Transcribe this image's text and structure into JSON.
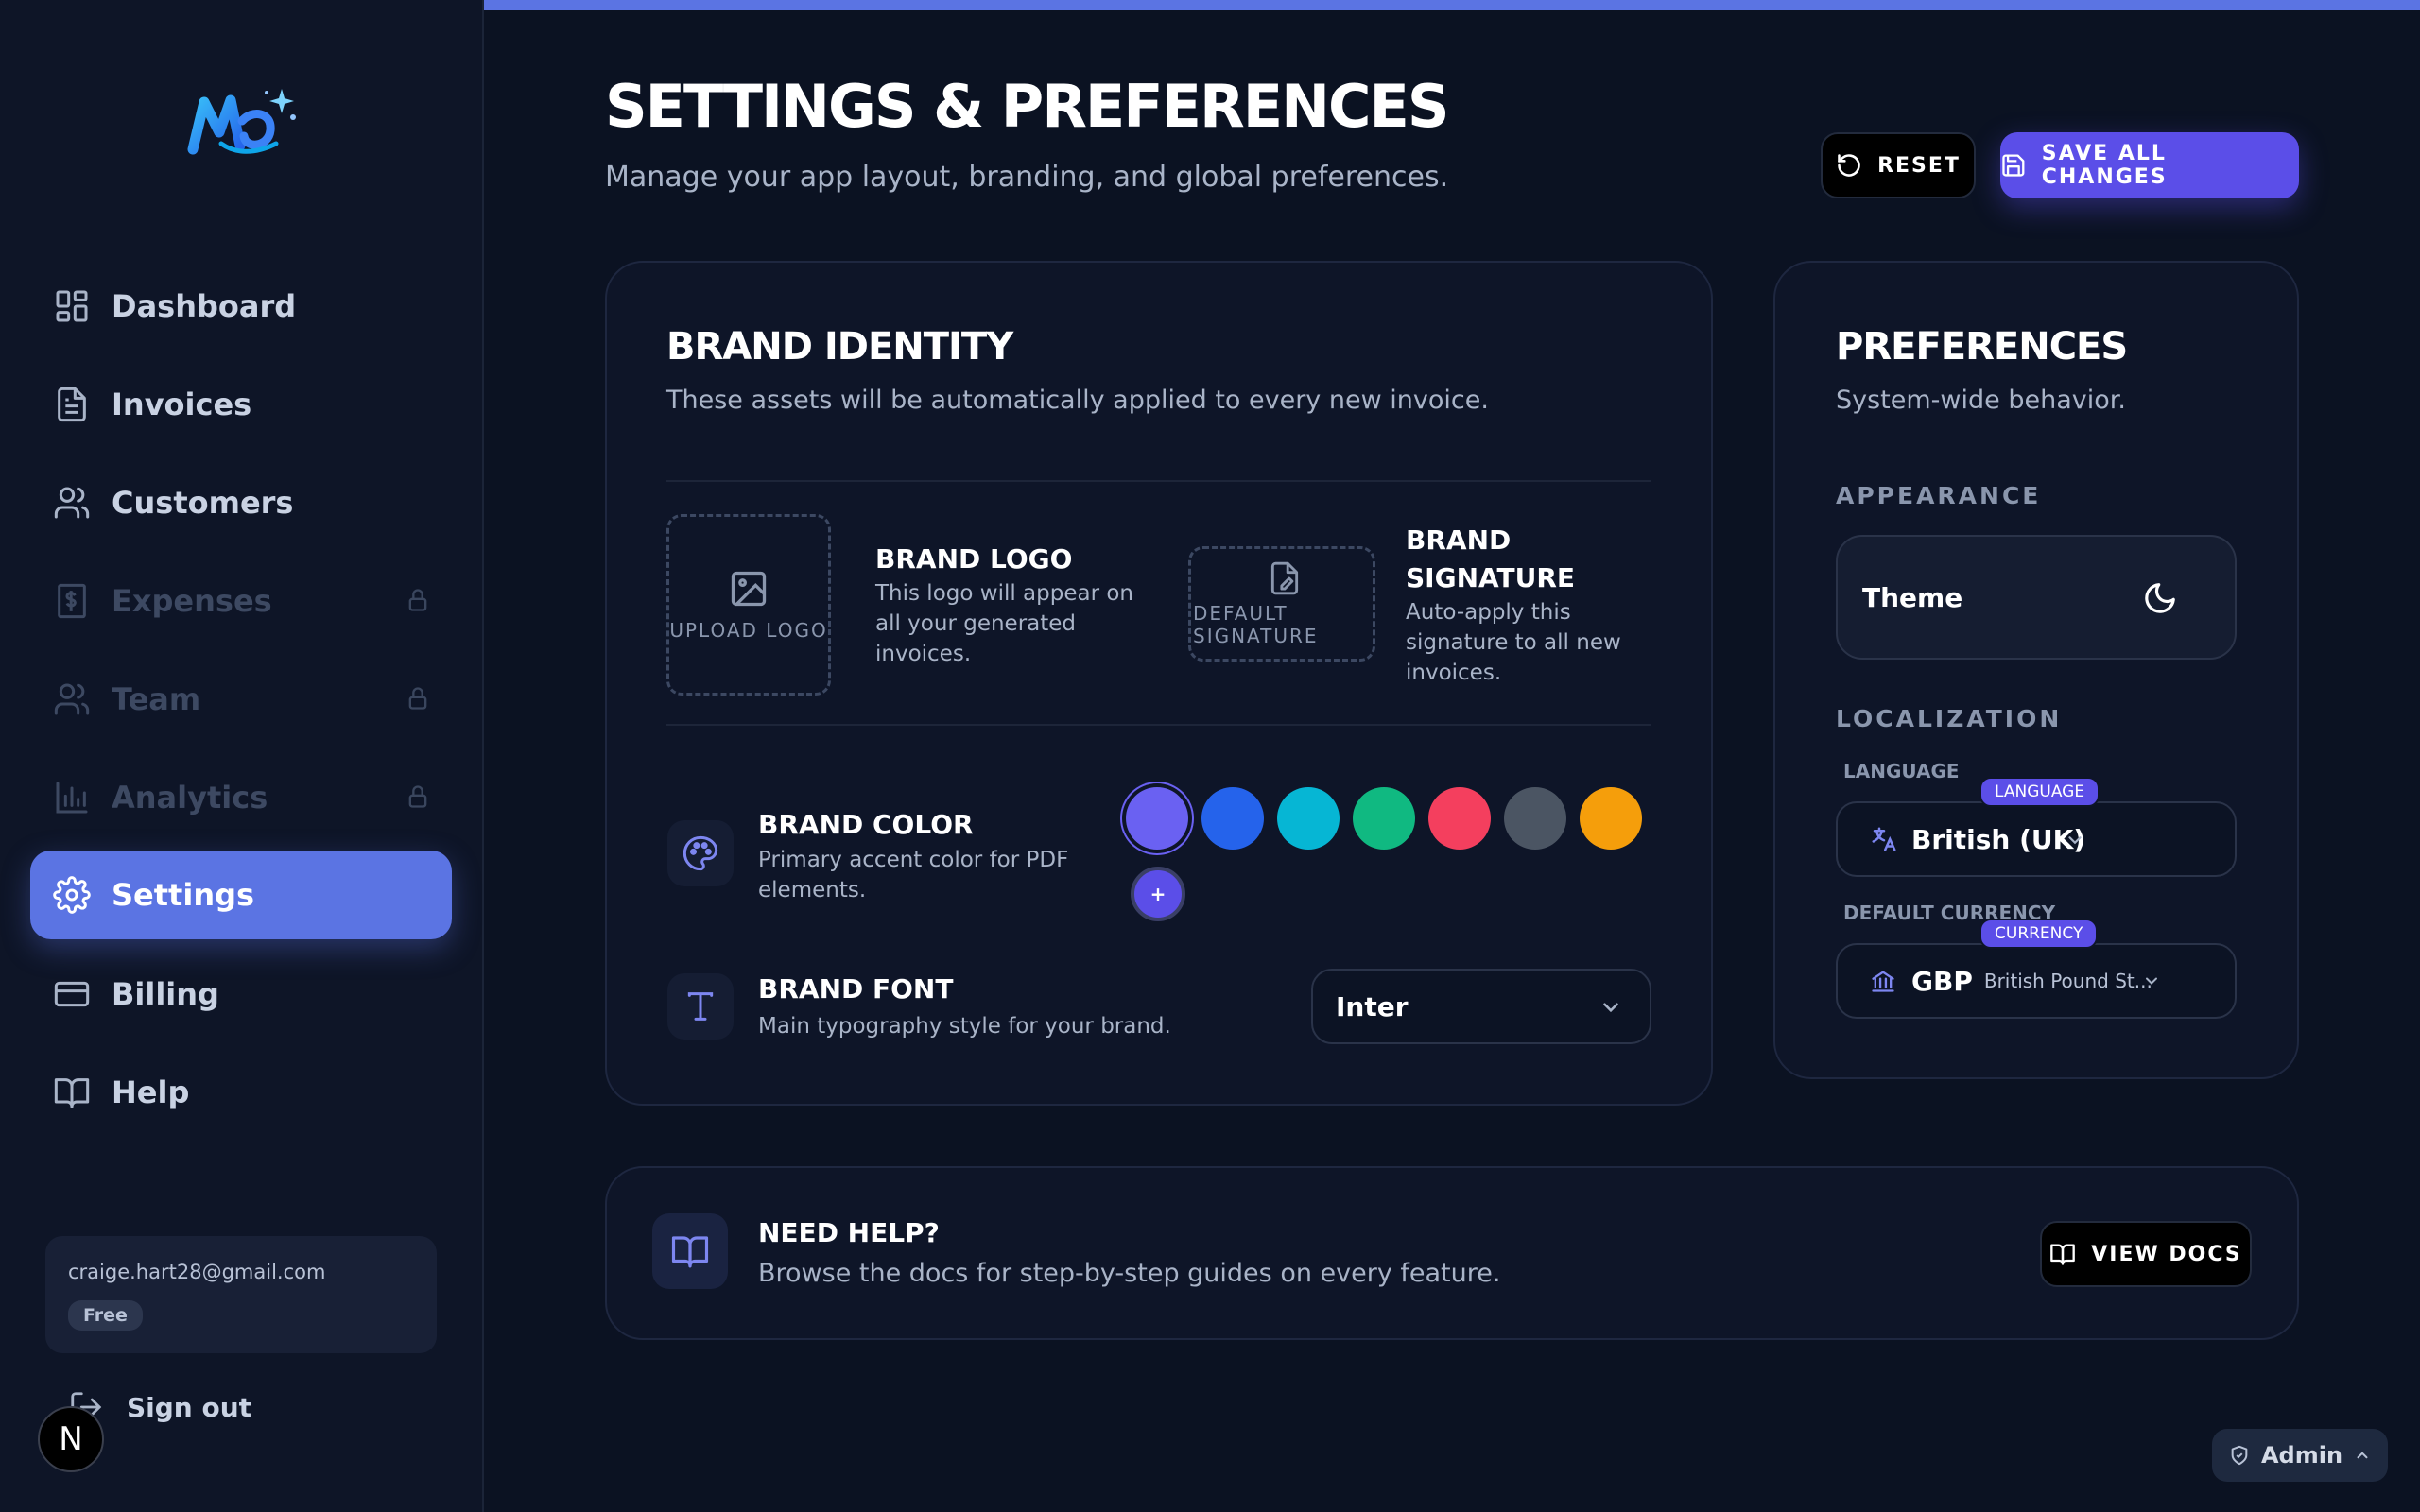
{
  "sidebar": {
    "items": [
      {
        "label": "Dashboard",
        "icon": "dashboard-icon",
        "locked": false,
        "active": false
      },
      {
        "label": "Invoices",
        "icon": "file-text-icon",
        "locked": false,
        "active": false
      },
      {
        "label": "Customers",
        "icon": "users-icon",
        "locked": false,
        "active": false
      },
      {
        "label": "Expenses",
        "icon": "receipt-icon",
        "locked": true,
        "active": false
      },
      {
        "label": "Team",
        "icon": "users-icon",
        "locked": true,
        "active": false
      },
      {
        "label": "Analytics",
        "icon": "bar-chart-icon",
        "locked": true,
        "active": false
      },
      {
        "label": "Settings",
        "icon": "gear-icon",
        "locked": false,
        "active": true
      },
      {
        "label": "Billing",
        "icon": "credit-card-icon",
        "locked": false,
        "active": false
      },
      {
        "label": "Help",
        "icon": "book-icon",
        "locked": false,
        "active": false
      }
    ],
    "account": {
      "email": "craige.hart28@gmail.com",
      "plan": "Free"
    },
    "signout_label": "Sign out",
    "n_badge": "N"
  },
  "header": {
    "title": "SETTINGS & PREFERENCES",
    "subtitle": "Manage your app layout, branding, and global preferences.",
    "reset_label": "RESET",
    "save_label": "SAVE ALL CHANGES"
  },
  "brand_identity": {
    "title": "BRAND IDENTITY",
    "subtitle": "These assets will be automatically applied to every new invoice.",
    "logo": {
      "upload_label": "UPLOAD LOGO",
      "title": "BRAND LOGO",
      "desc_lines": [
        "This logo will appear on",
        "all your generated",
        "invoices."
      ]
    },
    "signature": {
      "upload_label_lines": [
        "DEFAULT",
        "SIGNATURE"
      ],
      "title_lines": [
        "BRAND",
        "SIGNATURE"
      ],
      "desc_lines": [
        "Auto-apply this",
        "signature to all new",
        "invoices."
      ]
    },
    "color": {
      "title": "BRAND COLOR",
      "desc_lines": [
        "Primary accent color for PDF",
        "elements."
      ],
      "swatches": [
        "#6a61f2",
        "#2563eb",
        "#06b6d4",
        "#10b981",
        "#f43f5e",
        "#4b5563",
        "#f59e0b"
      ],
      "selected_index": 0,
      "add_label": "+"
    },
    "font": {
      "title": "BRAND FONT",
      "desc": "Main typography style for your brand.",
      "selected": "Inter"
    }
  },
  "preferences": {
    "title": "PREFERENCES",
    "subtitle": "System-wide behavior.",
    "appearance_label": "APPEARANCE",
    "theme_label": "Theme",
    "localization_label": "LOCALIZATION",
    "language": {
      "label": "LANGUAGE",
      "pill": "LANGUAGE",
      "value": "British (UK)"
    },
    "currency": {
      "label": "DEFAULT CURRENCY",
      "pill": "CURRENCY",
      "code": "GBP",
      "name": "British Pound St..."
    }
  },
  "help": {
    "title": "NEED HELP?",
    "desc": "Browse the docs for step-by-step guides on every feature.",
    "button_label": "VIEW DOCS"
  },
  "admin_chip": {
    "label": "Admin"
  },
  "colors": {
    "accent": "#5b74e3",
    "primary_button": "#5b4ee8",
    "background": "#0b1222"
  }
}
